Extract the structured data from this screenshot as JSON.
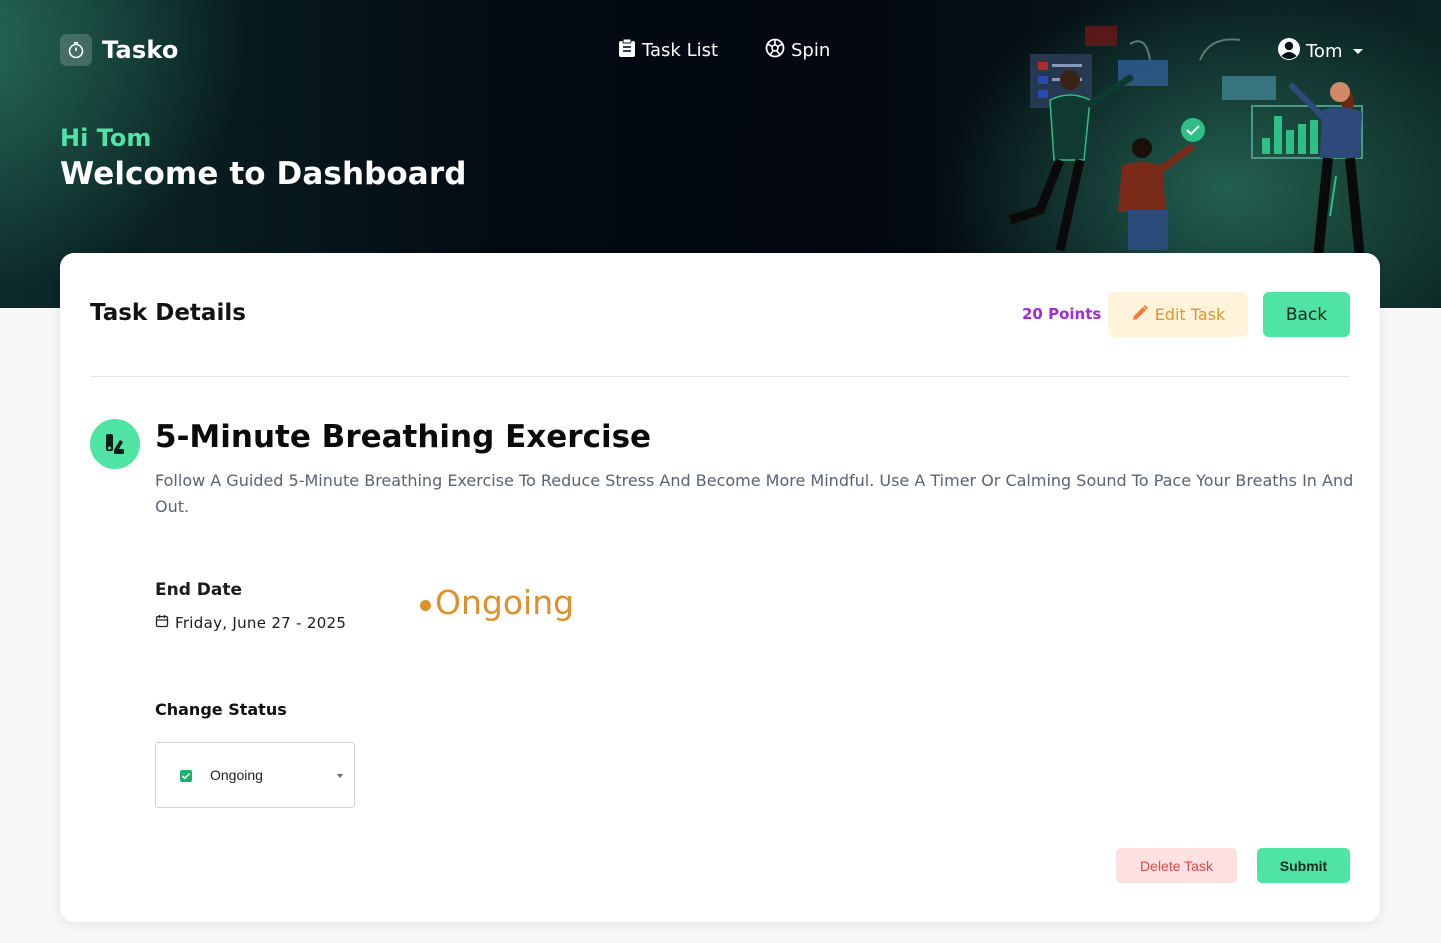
{
  "header": {
    "brand": "Tasko",
    "nav": [
      {
        "label": "Task List",
        "icon": "clipboard-icon"
      },
      {
        "label": "Spin",
        "icon": "wheel-icon"
      }
    ],
    "user": {
      "name": "Tom",
      "icon": "user-avatar-icon"
    },
    "greeting": "Hi Tom",
    "welcome": "Welcome to Dashboard"
  },
  "card": {
    "title": "Task Details",
    "points": "20 Points",
    "edit_label": "Edit Task",
    "back_label": "Back"
  },
  "task": {
    "title": "5-Minute Breathing Exercise",
    "description": "Follow A Guided 5-Minute Breathing Exercise To Reduce Stress And Become More Mindful. Use A Timer Or Calming Sound To Pace Your Breaths In And Out.",
    "end_date_label": "End Date",
    "end_date": "Friday, June 27 - 2025",
    "status": "Ongoing"
  },
  "status_change": {
    "label": "Change Status",
    "selected": "Ongoing"
  },
  "actions": {
    "delete_label": "Delete Task",
    "submit_label": "Submit"
  },
  "colors": {
    "accent": "#4fe3a4",
    "status_ongoing": "#e0902b",
    "points": "#a22bd6",
    "edit": "#e3932b",
    "delete": "#e04848"
  }
}
